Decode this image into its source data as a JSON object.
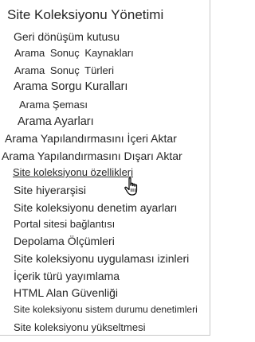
{
  "panel": {
    "title": "Site Koleksiyonu Yönetimi",
    "items": [
      {
        "label": "Geri dönüşüm kutusu"
      },
      {
        "label": "Arama Sonuç Kaynakları"
      },
      {
        "label": "Arama Sonuç Türleri"
      },
      {
        "label": "Arama Sorgu Kuralları"
      },
      {
        "label": "Arama Şeması"
      },
      {
        "label": "Arama Ayarları"
      },
      {
        "label": "Arama Yapılandırmasını İçeri Aktar"
      },
      {
        "label": "Arama Yapılandırmasını Dışarı Aktar"
      },
      {
        "label": "Site koleksiyonu özellikleri",
        "hovered": true
      },
      {
        "label": "Site hiyerarşisi"
      },
      {
        "label": "Site koleksiyonu denetim ayarları"
      },
      {
        "label": "Portal sitesi bağlantısı"
      },
      {
        "label": "Depolama Ölçümleri"
      },
      {
        "label": "Site koleksiyonu uygulaması izinleri"
      },
      {
        "label": "İçerik türü yayımlama"
      },
      {
        "label": "HTML Alan Güvenliği"
      },
      {
        "label": "Site koleksiyonu sistem durumu denetimleri"
      },
      {
        "label": "Site koleksiyonu yükseltmesi"
      }
    ]
  },
  "cursor": {
    "icon": "hand-pointer-icon"
  },
  "colors": {
    "text": "#262626",
    "border": "#c8c8c8",
    "background": "#ffffff"
  }
}
